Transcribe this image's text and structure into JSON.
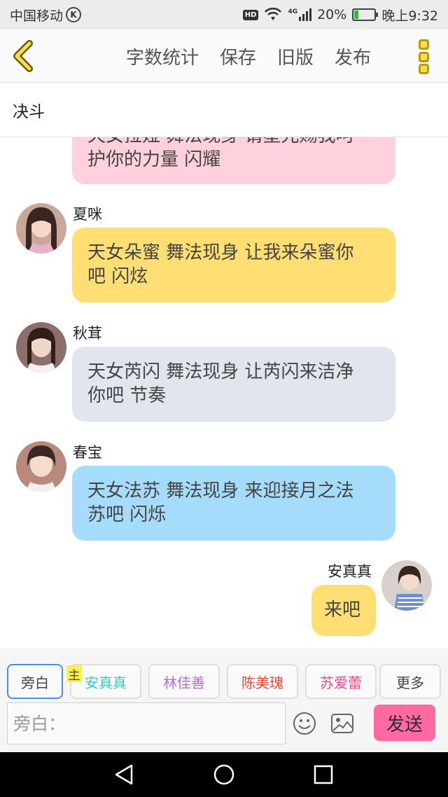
{
  "status_bar": {
    "carrier": "中国移动",
    "carrier_badge": "K",
    "hd_label": "HD",
    "network_label": "4G",
    "battery_percent": "20%",
    "battery_level": 0.2,
    "time": "晚上9:32"
  },
  "toolbar": {
    "back_icon": "chevron-left-icon",
    "actions": [
      "字数统计",
      "保存",
      "旧版",
      "发布"
    ],
    "more_icon": "more-vertical-icon"
  },
  "title": "决斗",
  "messages": [
    {
      "speaker": "",
      "text_line1": "天女拉娅 舞法现身 请星光赐我呵",
      "text_line2": "护你的力量 闪耀",
      "bubble_color": "#ffd1dd"
    },
    {
      "speaker": "夏咪",
      "text_line1": "天女朵蜜 舞法现身 让我来朵蜜你",
      "text_line2": "吧 闪炫",
      "bubble_color": "#ffdf73"
    },
    {
      "speaker": "秋茸",
      "text_line1": "天女芮闪 舞法现身 让芮闪来洁净",
      "text_line2": "你吧 节奏",
      "bubble_color": "#e0e5ee"
    },
    {
      "speaker": "春宝",
      "text_line1": "天女法苏 舞法现身 来迎接月之法",
      "text_line2": "苏吧 闪烁",
      "bubble_color": "#a6dcfb"
    },
    {
      "speaker": "安真真",
      "text_line1": "来吧",
      "bubble_color": "#ffdf73"
    }
  ],
  "characters": {
    "lead_tag": "主",
    "items": [
      {
        "label": "旁白",
        "color": "#444444"
      },
      {
        "label": "安真真",
        "color": "#3fc5c0"
      },
      {
        "label": "林佳善",
        "color": "#b66ccf"
      },
      {
        "label": "陈美瑰",
        "color": "#e2483c"
      },
      {
        "label": "苏爱蕾",
        "color": "#e0478e"
      },
      {
        "label": "更多",
        "color": "#444444"
      }
    ]
  },
  "composer": {
    "placeholder": "旁白：",
    "emoji_icon": "emoji-icon",
    "image_icon": "image-icon",
    "send_label": "发送"
  },
  "nav": {
    "back_icon": "nav-back-icon",
    "home_icon": "nav-home-icon",
    "recents_icon": "nav-recents-icon"
  },
  "colors": {
    "accent_yellow": "#f9de4c",
    "send_pink": "#ff6aa2",
    "selected_border": "#4a8ee0"
  }
}
